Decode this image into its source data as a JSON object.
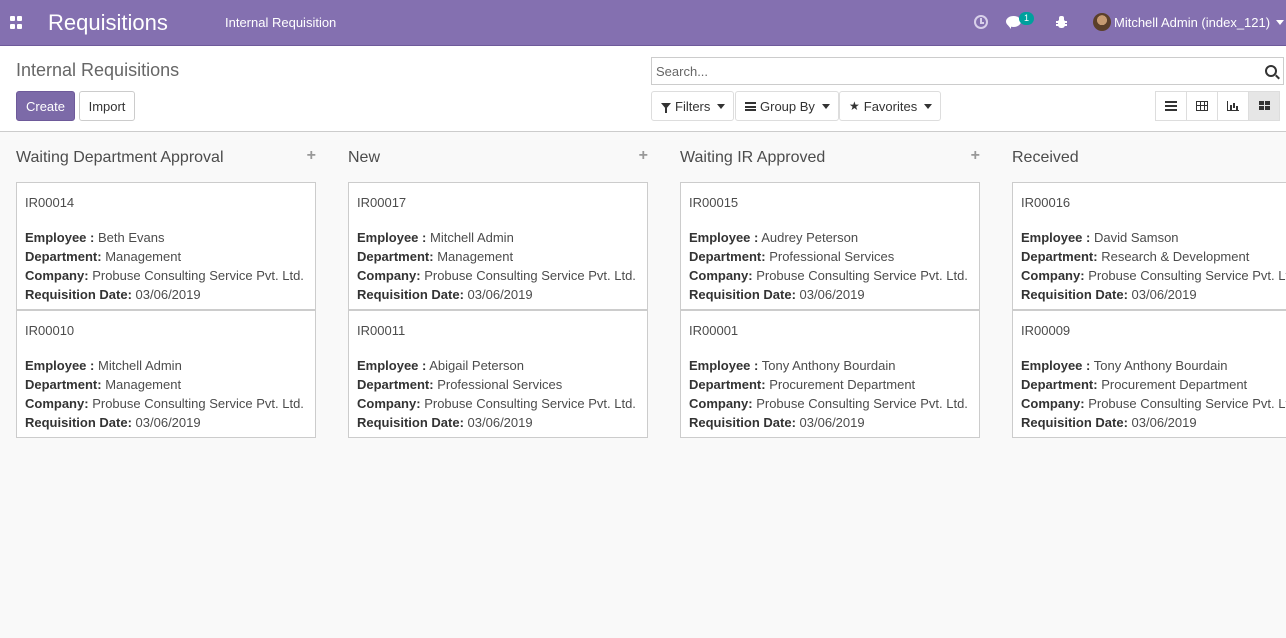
{
  "navbar": {
    "brand": "Requisitions",
    "menu_item": "Internal Requisition",
    "chat_count": "1",
    "user_name": "Mitchell Admin (index_121)"
  },
  "control_panel": {
    "breadcrumb": "Internal Requisitions",
    "create_label": "Create",
    "import_label": "Import",
    "search_placeholder": "Search...",
    "filters_label": "Filters",
    "groupby_label": "Group By",
    "favorites_label": "Favorites"
  },
  "labels": {
    "employee": "Employee :",
    "department": "Department:",
    "company": "Company:",
    "date": "Requisition Date:"
  },
  "columns": [
    {
      "title": "Waiting Department Approval",
      "add": "+",
      "cards": [
        {
          "ref": "IR00014",
          "employee": "Beth Evans",
          "department": "Management",
          "company": "Probuse Consulting Service Pvt. Ltd.",
          "date": "03/06/2019"
        },
        {
          "ref": "IR00010",
          "employee": "Mitchell Admin",
          "department": "Management",
          "company": "Probuse Consulting Service Pvt. Ltd.",
          "date": "03/06/2019"
        }
      ]
    },
    {
      "title": "New",
      "add": "+",
      "cards": [
        {
          "ref": "IR00017",
          "employee": "Mitchell Admin",
          "department": "Management",
          "company": "Probuse Consulting Service Pvt. Ltd.",
          "date": "03/06/2019"
        },
        {
          "ref": "IR00011",
          "employee": "Abigail Peterson",
          "department": "Professional Services",
          "company": "Probuse Consulting Service Pvt. Ltd.",
          "date": "03/06/2019"
        }
      ]
    },
    {
      "title": "Waiting IR Approved",
      "add": "+",
      "cards": [
        {
          "ref": "IR00015",
          "employee": "Audrey Peterson",
          "department": "Professional Services",
          "company": "Probuse Consulting Service Pvt. Ltd.",
          "date": "03/06/2019"
        },
        {
          "ref": "IR00001",
          "employee": "Tony Anthony Bourdain",
          "department": "Procurement Department",
          "company": "Probuse Consulting Service Pvt. Ltd.",
          "date": "03/06/2019"
        }
      ]
    },
    {
      "title": "Received",
      "add": "",
      "cards": [
        {
          "ref": "IR00016",
          "employee": "David Samson",
          "department": "Research & Development",
          "company": "Probuse Consulting Service Pvt. Ltd.",
          "date": "03/06/2019"
        },
        {
          "ref": "IR00009",
          "employee": "Tony Anthony Bourdain",
          "department": "Procurement Department",
          "company": "Probuse Consulting Service Pvt. Ltd.",
          "date": "03/06/2019"
        }
      ]
    }
  ]
}
